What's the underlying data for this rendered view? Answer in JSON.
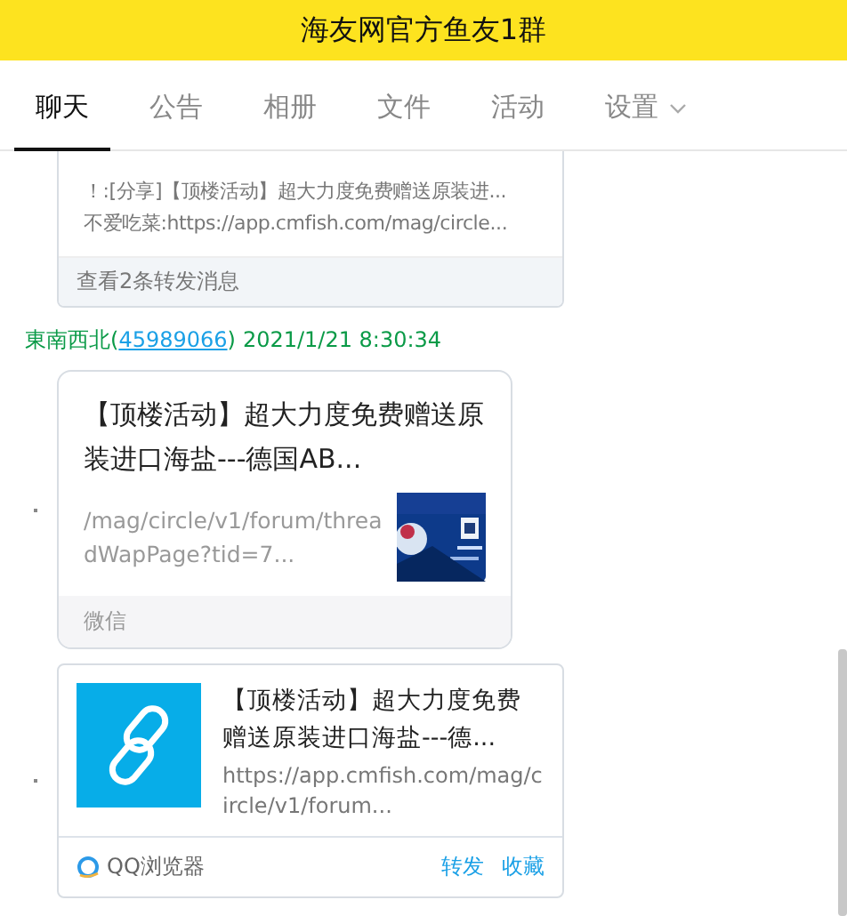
{
  "header": {
    "title": "海友网官方鱼友1群"
  },
  "tabs": [
    {
      "label": "聊天",
      "selected": true,
      "dropdown": false
    },
    {
      "label": "公告",
      "selected": false,
      "dropdown": false
    },
    {
      "label": "相册",
      "selected": false,
      "dropdown": false
    },
    {
      "label": "文件",
      "selected": false,
      "dropdown": false
    },
    {
      "label": "活动",
      "selected": false,
      "dropdown": false
    },
    {
      "label": "设置",
      "selected": false,
      "dropdown": true
    }
  ],
  "messages": [
    {
      "kind": "forward",
      "lines": [
        "！:[分享]【顶楼活动】超大力度免费赠送原装进...",
        "不爱吃菜:https://app.cmfish.com/mag/circle..."
      ],
      "footer": "查看2条转发消息"
    },
    {
      "kind": "sender",
      "name": "東南西北(",
      "id": "45989066",
      "id_close": ")",
      "time": "2021/1/21 8:30:34"
    },
    {
      "kind": "wechat",
      "title": "【顶楼活动】超大力度免费赠送原装进口海盐---德国AB...",
      "desc": "/mag/circle/v1/forum/threadWapPage?tid=7...",
      "source": "微信"
    },
    {
      "kind": "link",
      "title": "【顶楼活动】超大力度免费赠送原装进口海盐---德...",
      "desc": "https://app.cmfish.com/mag/circle/v1/forum...",
      "source": "QQ浏览器",
      "actions": [
        "转发",
        "收藏"
      ]
    }
  ]
}
